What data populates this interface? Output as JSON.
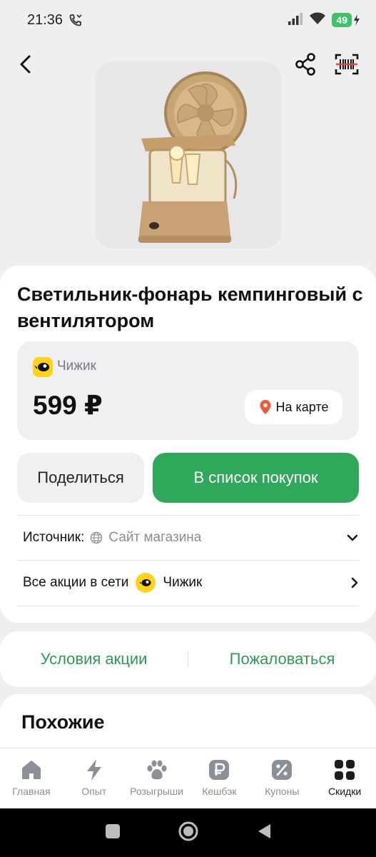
{
  "status": {
    "time": "21:36",
    "battery": "49",
    "icons": [
      "wifi-call-icon",
      "signal-icon",
      "wifi-icon",
      "battery-icon"
    ]
  },
  "header": {
    "icons": [
      "back-icon",
      "share-icon",
      "barcode-scan-icon"
    ]
  },
  "product": {
    "title": "Светильник-фонарь кемпинговый с вентилятором",
    "store": "Чижик",
    "price": "599 ₽",
    "map_button": "На карте"
  },
  "actions": {
    "share": "Поделиться",
    "add_to_list": "В список покупок"
  },
  "source": {
    "label": "Источник:",
    "value": "Сайт магазина"
  },
  "all_promos": {
    "label": "Все акции в сети",
    "store": "Чижик"
  },
  "links": {
    "conditions": "Условия акции",
    "complain": "Пожаловаться"
  },
  "similar": {
    "title": "Похожие"
  },
  "bottom_nav": {
    "items": [
      {
        "label": "Главная",
        "icon": "home-icon"
      },
      {
        "label": "Опыт",
        "icon": "lightning-icon"
      },
      {
        "label": "Розыгрыши",
        "icon": "paw-icon"
      },
      {
        "label": "Кешбэк",
        "icon": "ruble-icon"
      },
      {
        "label": "Купоны",
        "icon": "percent-icon"
      },
      {
        "label": "Скидки",
        "icon": "grid-icon"
      }
    ],
    "active_index": 5
  },
  "colors": {
    "accent_green": "#2fa85b",
    "link_green": "#2c9a52",
    "store_yellow": "#ffd21c",
    "map_pin": "#f1573d"
  }
}
